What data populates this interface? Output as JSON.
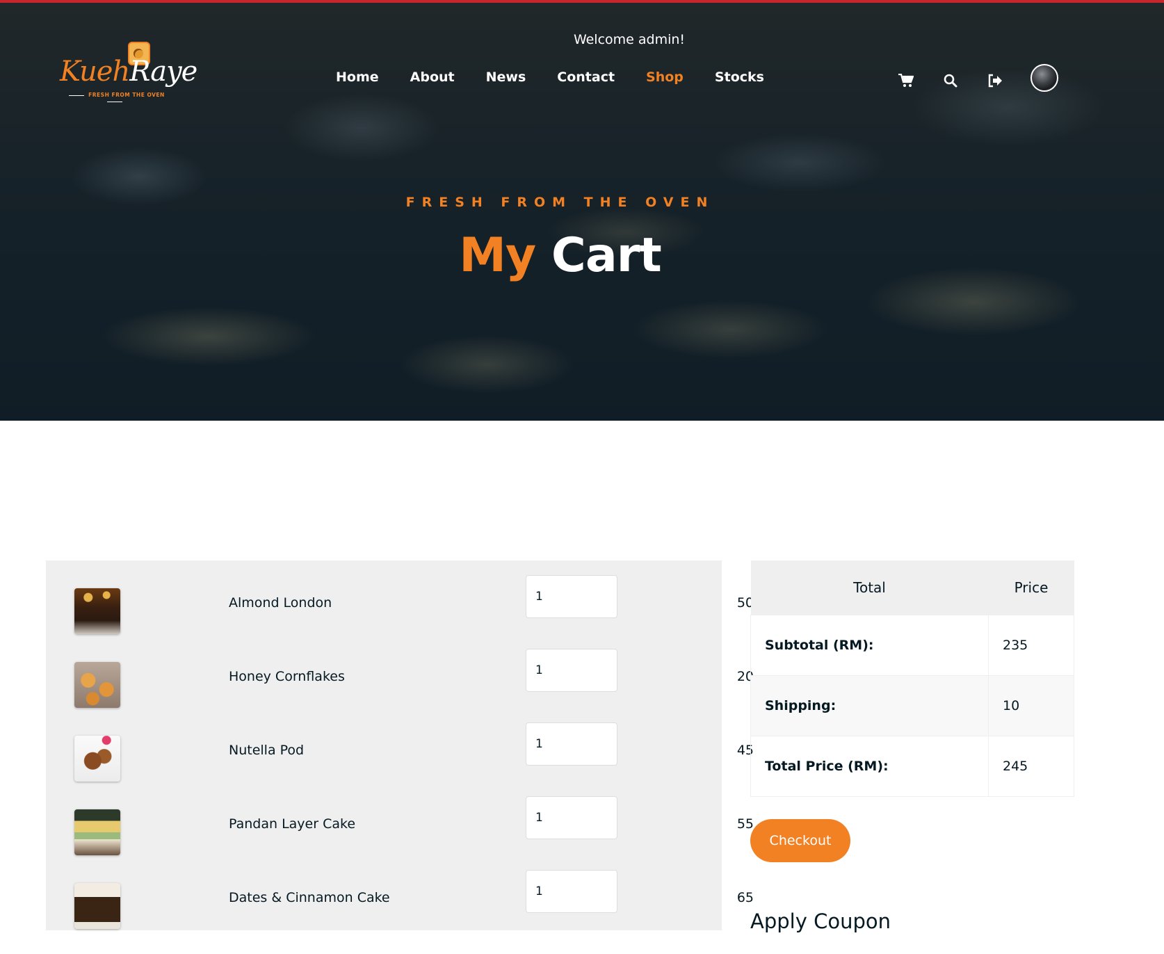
{
  "brand": {
    "part1": "Kueh",
    "part2": "Raye",
    "tagline": "FRESH FROM THE OVEN"
  },
  "header": {
    "welcome": "Welcome admin!",
    "nav": [
      "Home",
      "About",
      "News",
      "Contact",
      "Shop",
      "Stocks"
    ],
    "active_nav": "Shop",
    "icons": [
      "cart-icon",
      "search-icon",
      "logout-icon",
      "avatar"
    ]
  },
  "hero": {
    "subtitle": "FRESH FROM THE OVEN",
    "title_accent": "My",
    "title_rest": "Cart"
  },
  "cart": {
    "items": [
      {
        "name": "Almond London",
        "price": "50",
        "qty": "1",
        "total": "50"
      },
      {
        "name": "Honey Cornflakes",
        "price": "20",
        "qty": "1",
        "total": "20"
      },
      {
        "name": "Nutella Pod",
        "price": "45",
        "qty": "1",
        "total": "45"
      },
      {
        "name": "Pandan Layer Cake",
        "price": "55",
        "qty": "1",
        "total": "55"
      },
      {
        "name": "Dates & Cinnamon Cake",
        "price": "65",
        "qty": "1",
        "total": "65"
      }
    ]
  },
  "totals": {
    "headers": [
      "Total",
      "Price"
    ],
    "rows": [
      {
        "label": "Subtotal (RM):",
        "value": "235"
      },
      {
        "label": "Shipping:",
        "value": "10"
      },
      {
        "label": "Total Price (RM):",
        "value": "245"
      }
    ]
  },
  "actions": {
    "checkout": "Checkout",
    "coupon_title": "Apply Coupon"
  },
  "colors": {
    "accent": "#f28123",
    "dark": "#051922",
    "top_bar": "#c8262d"
  }
}
